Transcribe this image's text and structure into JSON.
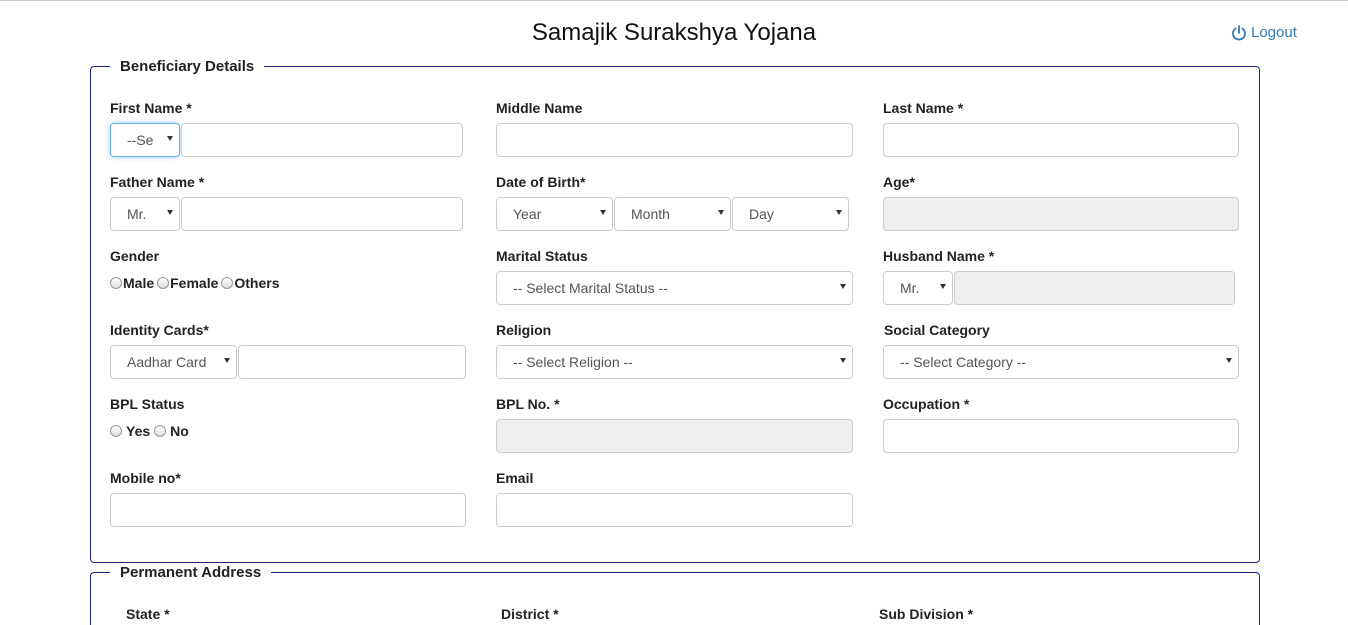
{
  "header": {
    "title": "Samajik Surakshya Yojana",
    "logout_label": "Logout"
  },
  "beneficiary": {
    "legend": "Beneficiary Details",
    "first_name": {
      "label": "First Name *",
      "title_select": "--Se",
      "value": ""
    },
    "middle_name": {
      "label": "Middle Name",
      "value": ""
    },
    "last_name": {
      "label": "Last Name *",
      "value": ""
    },
    "father_name": {
      "label": "Father Name *",
      "title_select": "Mr.",
      "value": ""
    },
    "dob": {
      "label": "Date of Birth*",
      "year": "Year",
      "month": "Month",
      "day": "Day"
    },
    "age": {
      "label": "Age*",
      "value": ""
    },
    "gender": {
      "label": "Gender",
      "options": [
        "Male",
        "Female",
        "Others"
      ]
    },
    "marital_status": {
      "label": "Marital Status",
      "selected": "-- Select Marital Status --"
    },
    "husband_name": {
      "label": "Husband Name *",
      "title_select": "Mr.",
      "value": ""
    },
    "identity": {
      "label": "Identity Cards*",
      "selected": "Aadhar Card",
      "value": ""
    },
    "religion": {
      "label": "Religion",
      "selected": "-- Select Religion --"
    },
    "social_category": {
      "label": "Social Category",
      "selected": "-- Select Category --"
    },
    "bpl_status": {
      "label": "BPL Status",
      "options": [
        "Yes",
        "No"
      ]
    },
    "bpl_no": {
      "label": "BPL No. *",
      "value": ""
    },
    "occupation": {
      "label": "Occupation *",
      "value": ""
    },
    "mobile": {
      "label": "Mobile no*",
      "value": ""
    },
    "email": {
      "label": "Email",
      "value": ""
    }
  },
  "address": {
    "legend": "Permanent Address",
    "state_label": "State *",
    "district_label": "District *",
    "subdivision_label": "Sub Division *"
  }
}
